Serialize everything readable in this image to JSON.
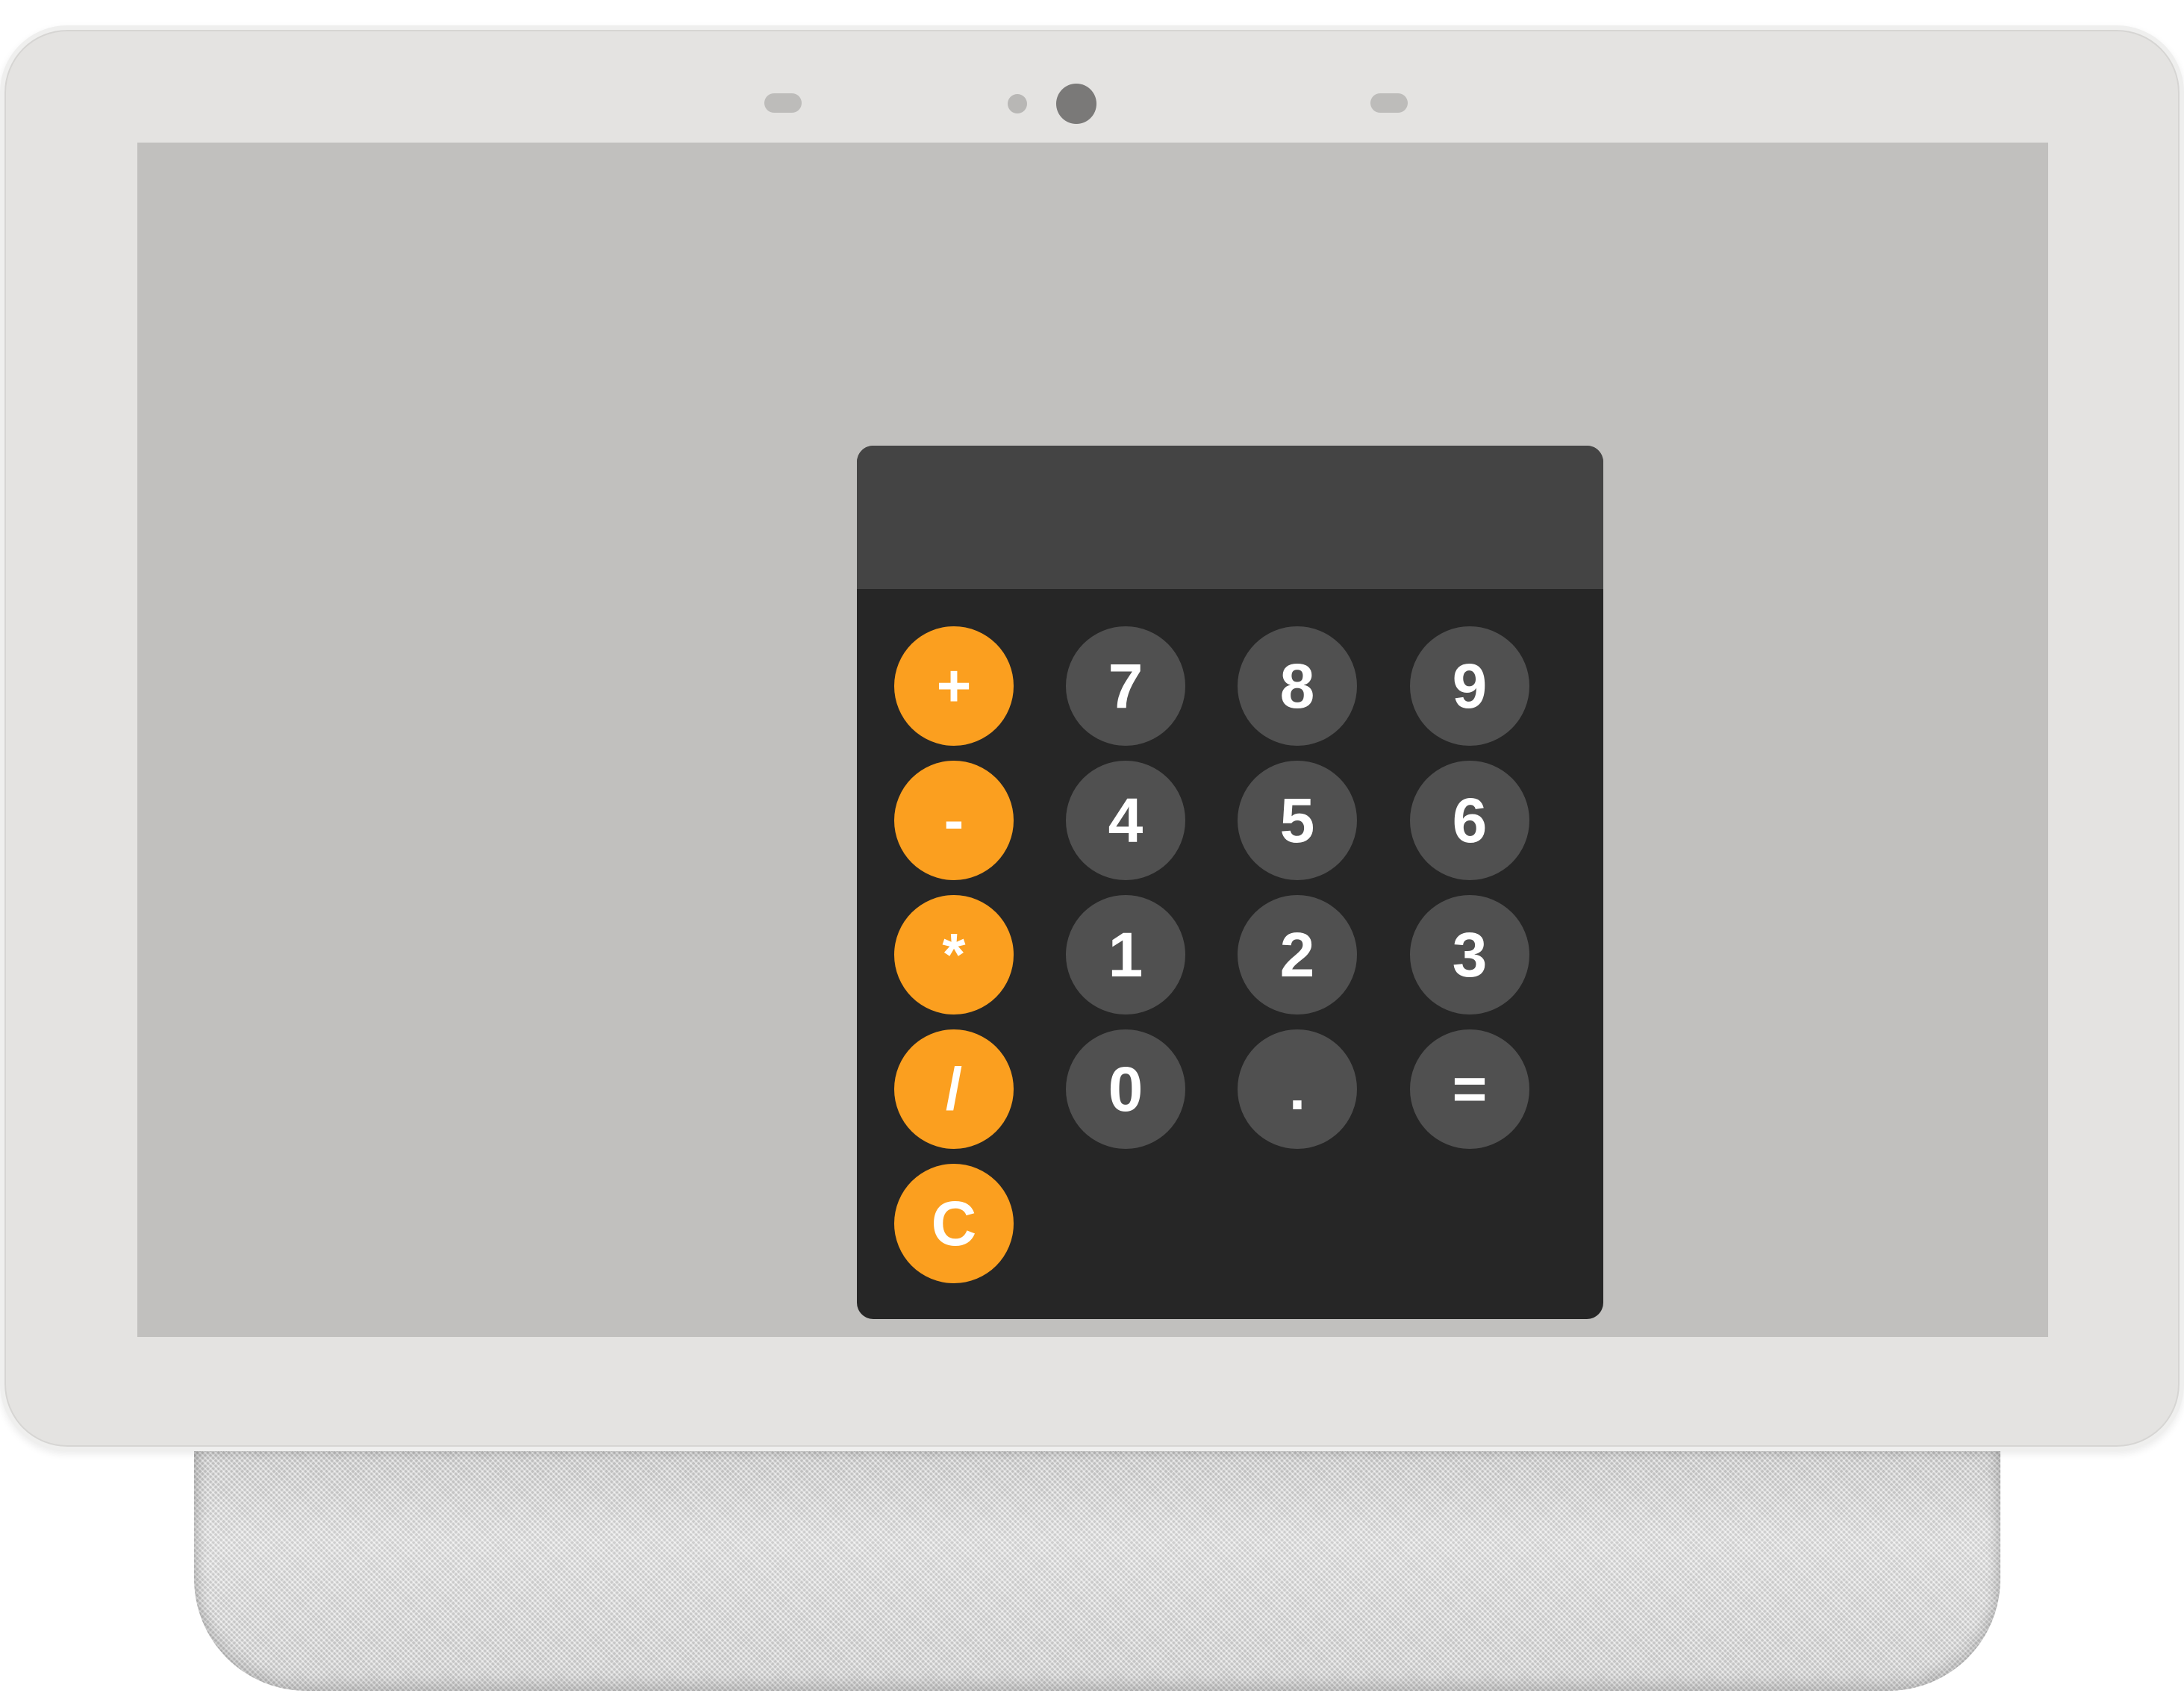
{
  "device": {
    "bezel_color": "#e4e3e1",
    "screen_color": "#c1c0be"
  },
  "calculator": {
    "display_value": "",
    "colors": {
      "body": "#262626",
      "display": "#444444",
      "operator_key": "#fb9f1f",
      "number_key": "#505050",
      "key_text": "#ffffff"
    },
    "keys": {
      "plus": "+",
      "minus": "-",
      "multiply": "*",
      "divide": "/",
      "clear": "C",
      "seven": "7",
      "eight": "8",
      "nine": "9",
      "four": "4",
      "five": "5",
      "six": "6",
      "one": "1",
      "two": "2",
      "three": "3",
      "zero": "0",
      "decimal": ".",
      "equals": "="
    }
  }
}
